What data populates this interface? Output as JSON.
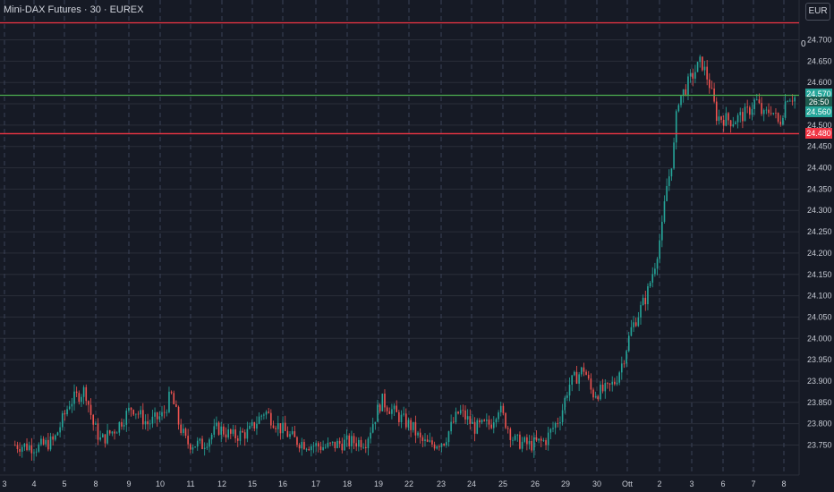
{
  "header": {
    "symbol_title": "Mini-DAX Futures · 30 · EUREX",
    "currency_button": "EUR",
    "indicator_value": "0"
  },
  "colors": {
    "background": "#161a25",
    "grid": "#2a2e39",
    "up": "#26a69a",
    "down": "#ef5350",
    "level_line": "#f23645",
    "price_line": "#4caf50"
  },
  "chart_data": {
    "type": "candlestick",
    "title": "Mini-DAX Futures · 30 · EUREX",
    "ylim": [
      23730,
      24750
    ],
    "y_ticks": [
      "24.700",
      "24.650",
      "24.600",
      "24.550",
      "24.500",
      "24.450",
      "24.400",
      "24.350",
      "24.300",
      "24.250",
      "24.200",
      "24.150",
      "24.100",
      "24.050",
      "24.000",
      "23.950",
      "23.900",
      "23.850",
      "23.800",
      "23.750"
    ],
    "x_ticks": [
      "3",
      "4",
      "5",
      "8",
      "9",
      "10",
      "11",
      "12",
      "15",
      "16",
      "17",
      "18",
      "19",
      "22",
      "23",
      "24",
      "25",
      "26",
      "29",
      "30",
      "Ott",
      "2",
      "3",
      "6",
      "7",
      "8"
    ],
    "horizontal_levels": [
      {
        "value": 24740,
        "color": "#f23645"
      },
      {
        "value": 24570,
        "color": "#4caf50"
      },
      {
        "value": 24480,
        "color": "#f23645"
      }
    ],
    "price_tags": [
      {
        "text": "24.570",
        "value": 24574,
        "color": "#26a69a"
      },
      {
        "text": "26:50",
        "value": 24555,
        "color": "#1e5a4e"
      },
      {
        "text": "24.560",
        "value": 24532,
        "color": "#26a69a"
      },
      {
        "text": "24.480",
        "value": 24480,
        "color": "#f23645"
      }
    ],
    "price_path_keypoints": [
      [
        0,
        23750
      ],
      [
        0.03,
        23745
      ],
      [
        0.05,
        23760
      ],
      [
        0.07,
        23850
      ],
      [
        0.09,
        23880
      ],
      [
        0.1,
        23800
      ],
      [
        0.11,
        23760
      ],
      [
        0.13,
        23790
      ],
      [
        0.15,
        23840
      ],
      [
        0.17,
        23800
      ],
      [
        0.19,
        23820
      ],
      [
        0.2,
        23870
      ],
      [
        0.21,
        23800
      ],
      [
        0.22,
        23755
      ],
      [
        0.24,
        23750
      ],
      [
        0.26,
        23790
      ],
      [
        0.28,
        23770
      ],
      [
        0.3,
        23780
      ],
      [
        0.32,
        23830
      ],
      [
        0.34,
        23790
      ],
      [
        0.36,
        23760
      ],
      [
        0.38,
        23750
      ],
      [
        0.4,
        23745
      ],
      [
        0.42,
        23755
      ],
      [
        0.45,
        23760
      ],
      [
        0.47,
        23855
      ],
      [
        0.49,
        23820
      ],
      [
        0.51,
        23790
      ],
      [
        0.52,
        23760
      ],
      [
        0.53,
        23750
      ],
      [
        0.55,
        23760
      ],
      [
        0.57,
        23830
      ],
      [
        0.59,
        23790
      ],
      [
        0.61,
        23800
      ],
      [
        0.62,
        23840
      ],
      [
        0.64,
        23760
      ],
      [
        0.66,
        23750
      ],
      [
        0.68,
        23760
      ],
      [
        0.7,
        23820
      ],
      [
        0.71,
        23890
      ],
      [
        0.73,
        23930
      ],
      [
        0.74,
        23870
      ],
      [
        0.76,
        23880
      ],
      [
        0.77,
        23900
      ],
      [
        0.78,
        23950
      ],
      [
        0.79,
        24020
      ],
      [
        0.8,
        24060
      ],
      [
        0.81,
        24100
      ],
      [
        0.82,
        24170
      ],
      [
        0.83,
        24260
      ],
      [
        0.835,
        24350
      ],
      [
        0.84,
        24390
      ],
      [
        0.845,
        24450
      ],
      [
        0.85,
        24560
      ],
      [
        0.855,
        24570
      ],
      [
        0.87,
        24620
      ],
      [
        0.88,
        24650
      ],
      [
        0.89,
        24600
      ],
      [
        0.9,
        24520
      ],
      [
        0.92,
        24510
      ],
      [
        0.94,
        24530
      ],
      [
        0.95,
        24560
      ],
      [
        0.96,
        24520
      ],
      [
        0.97,
        24540
      ],
      [
        0.98,
        24500
      ],
      [
        0.99,
        24570
      ],
      [
        1.0,
        24565
      ]
    ]
  }
}
